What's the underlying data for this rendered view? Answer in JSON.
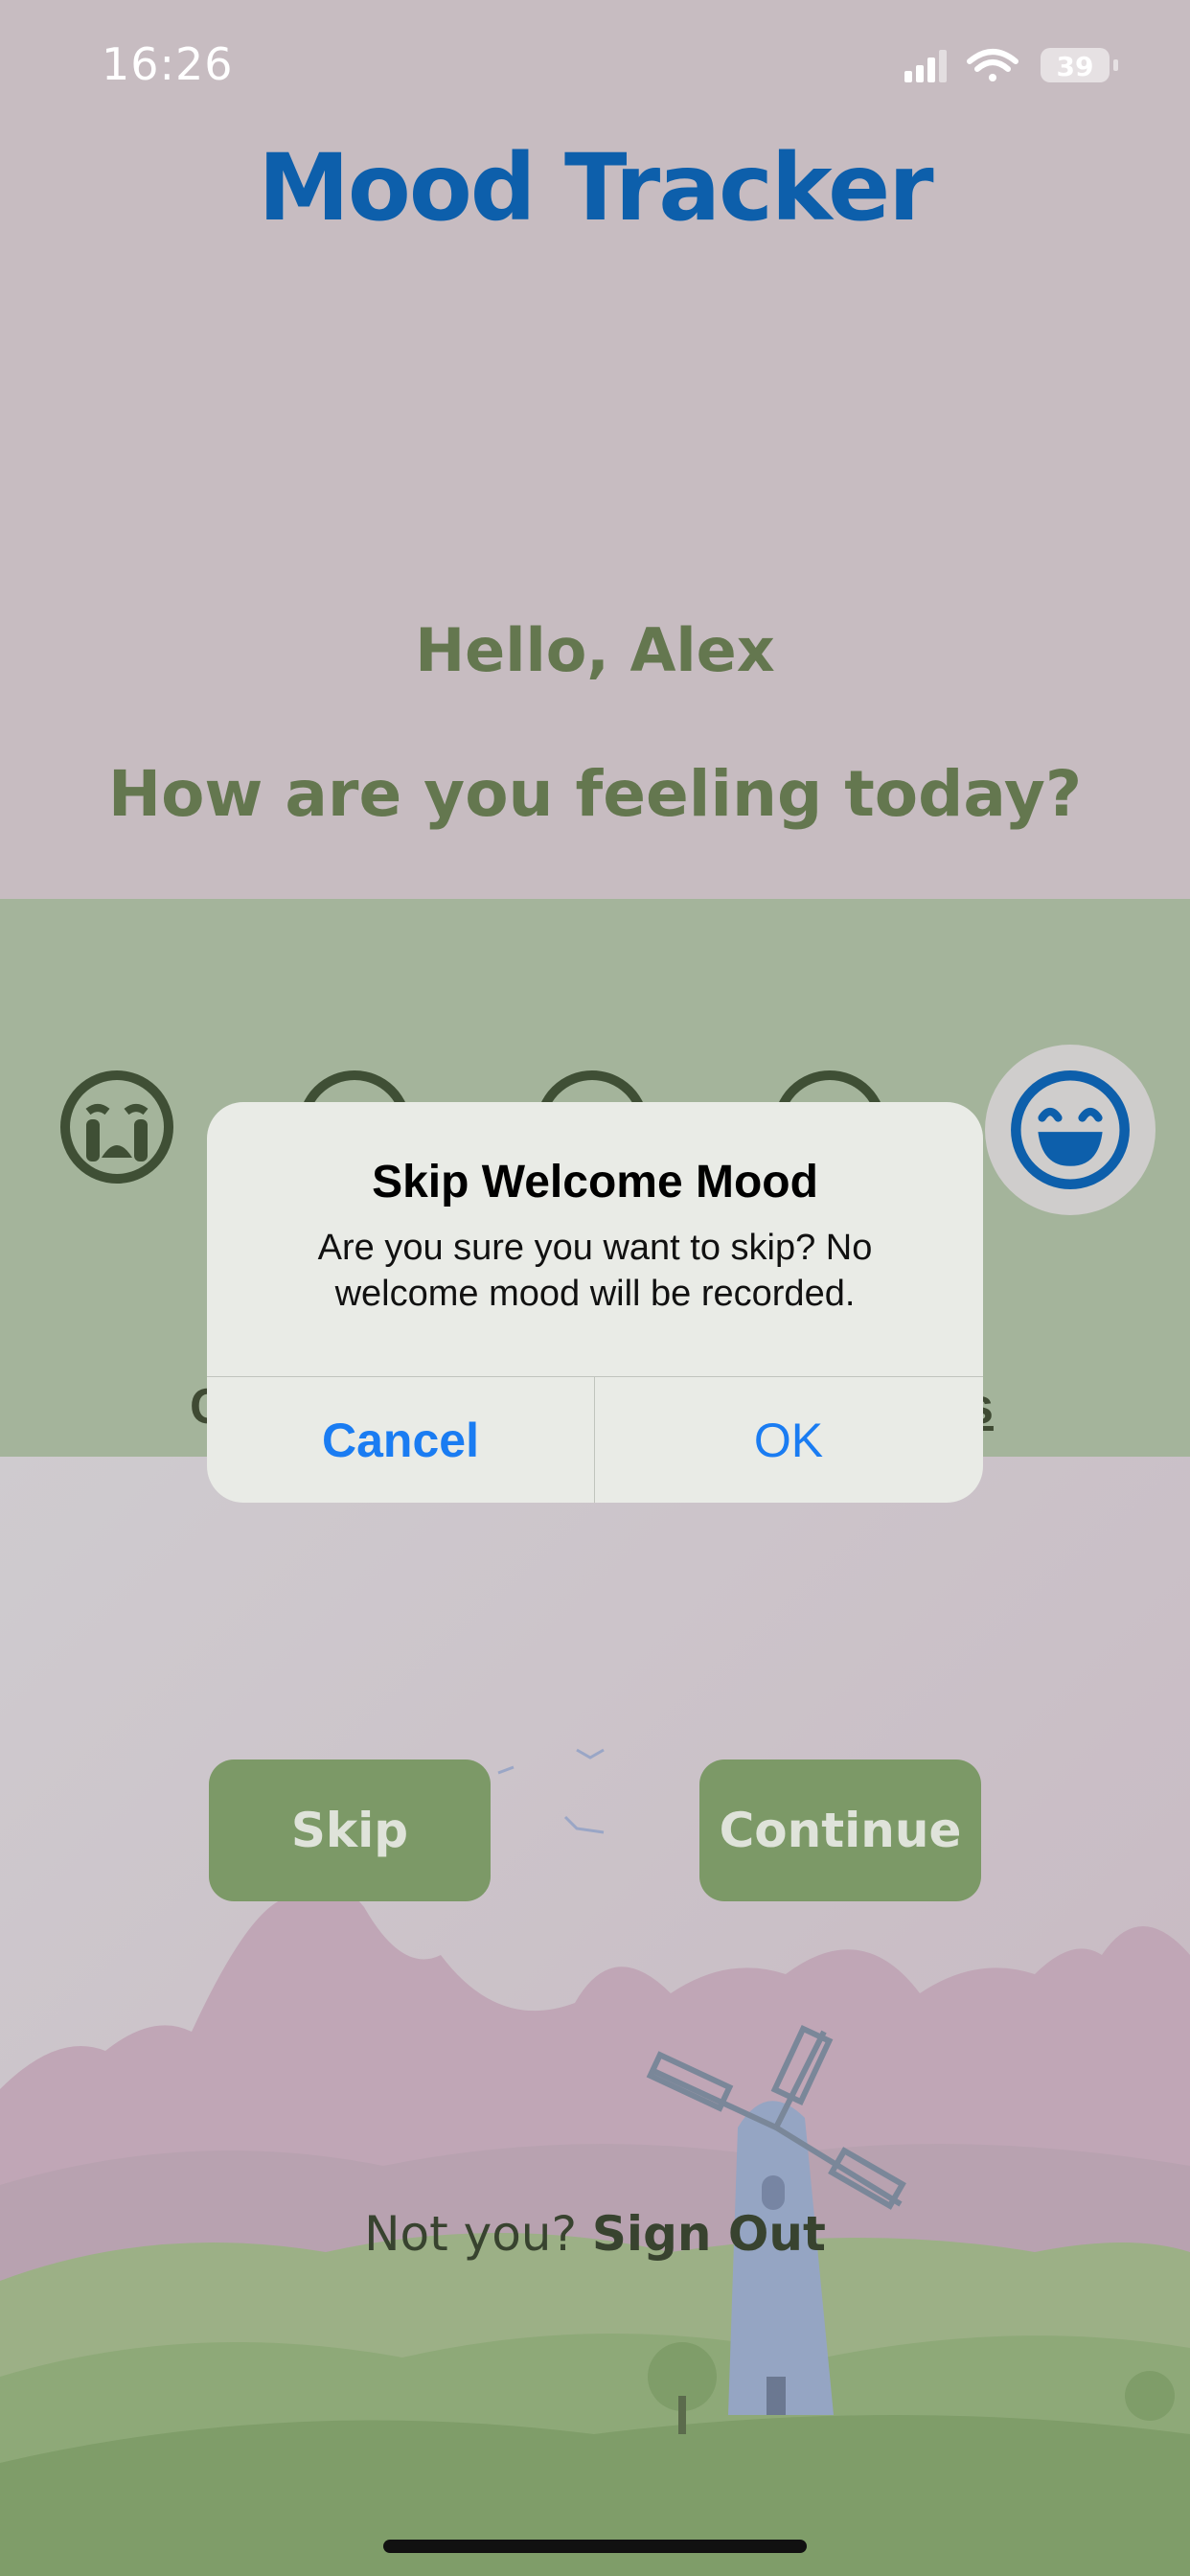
{
  "status_bar": {
    "time": "16:26",
    "battery": "39"
  },
  "app": {
    "title": "Mood Tracker"
  },
  "greeting": "Hello, Alex",
  "question": "How are you feeling today?",
  "mood_options": [
    {
      "icon": "crying-face-icon"
    },
    {
      "icon": "sad-face-icon"
    },
    {
      "icon": "neutral-face-icon"
    },
    {
      "icon": "smiling-face-icon"
    },
    {
      "icon": "grinning-face-icon",
      "selected": true
    }
  ],
  "partial_labels": {
    "left": "C",
    "right": "s"
  },
  "buttons": {
    "skip": "Skip",
    "continue": "Continue"
  },
  "signout": {
    "prompt": "Not you?",
    "link": "Sign Out"
  },
  "alert": {
    "title": "Skip Welcome Mood",
    "message": "Are you sure you want to skip? No welcome mood will be recorded.",
    "cancel": "Cancel",
    "ok": "OK"
  },
  "colors": {
    "brand": "#0d5fab",
    "button": "#7c9967",
    "alert_action": "#1a7cf2"
  }
}
